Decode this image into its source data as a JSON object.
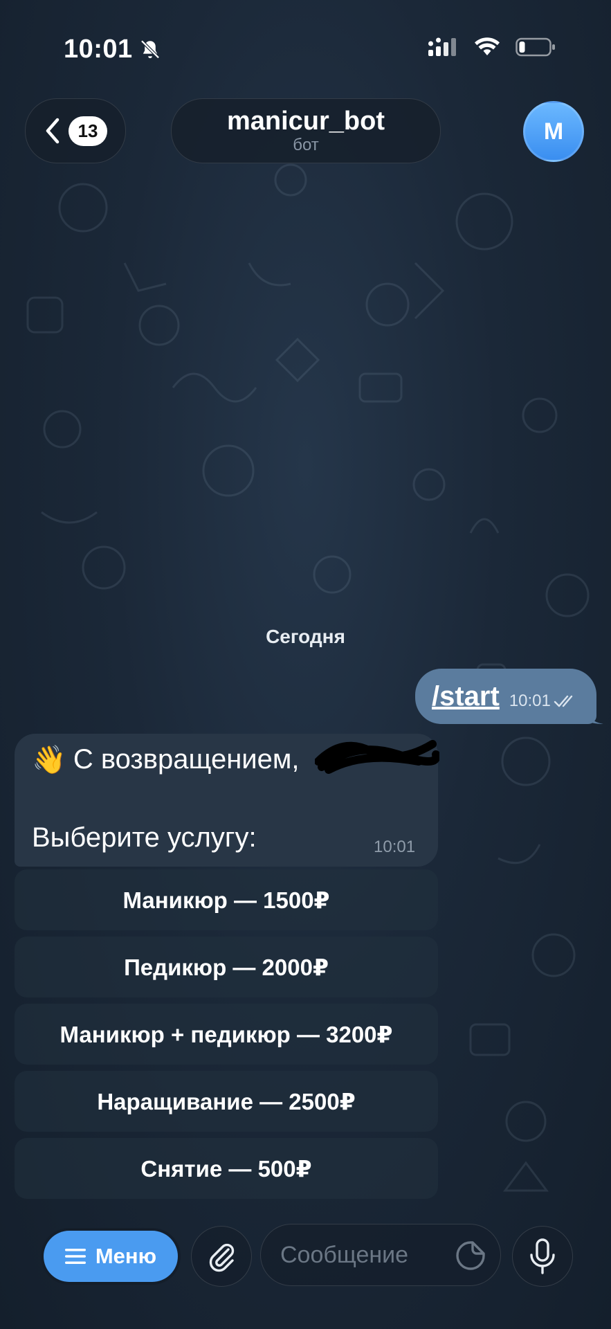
{
  "status_bar": {
    "time": "10:01",
    "icons": [
      "bell-slash-icon",
      "signal-icon",
      "wifi-icon",
      "battery-icon"
    ]
  },
  "header": {
    "back_badge": "13",
    "title": "manicur_bot",
    "subtitle": "бот",
    "avatar_letter": "M"
  },
  "chat": {
    "date_label": "Сегодня",
    "outgoing": {
      "text": "/start",
      "time": "10:01",
      "status": "read"
    },
    "incoming": {
      "emoji": "👋",
      "line1": "С возвращением,",
      "line2": "Выберите услугу:",
      "time": "10:01"
    }
  },
  "keyboard": {
    "buttons": [
      "Маникюр — 1500₽",
      "Педикюр — 2000₽",
      "Маникюр + педикюр — 3200₽",
      "Наращивание — 2500₽",
      "Снятие — 500₽"
    ]
  },
  "input_bar": {
    "menu_label": "Меню",
    "placeholder": "Сообщение"
  },
  "colors": {
    "accent": "#4a9bf0",
    "outgoing_bubble": "#5b7c9e",
    "incoming_bubble": "#283646",
    "background": "#1b2838"
  }
}
